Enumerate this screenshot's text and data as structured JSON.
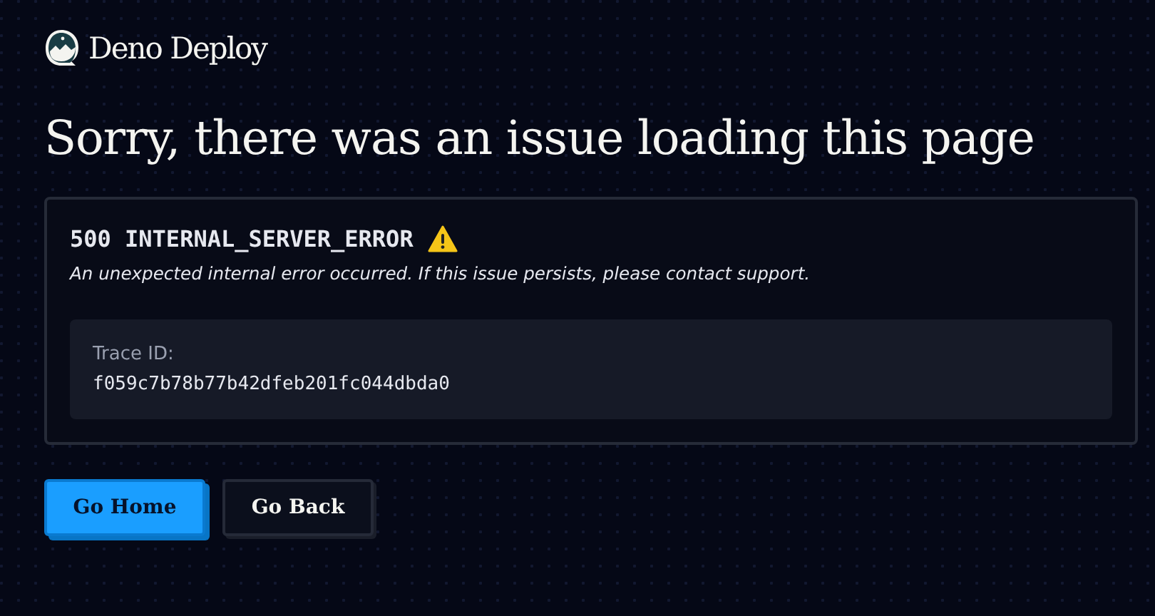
{
  "brand": {
    "name": "Deno Deploy"
  },
  "heading": "Sorry, there was an issue loading this page",
  "error": {
    "code": "500 INTERNAL_SERVER_ERROR",
    "message": "An unexpected internal error occurred. If this issue persists, please contact support.",
    "trace_label": "Trace ID:",
    "trace_id": "f059c7b78b77b42dfeb201fc044dbda0"
  },
  "buttons": [
    {
      "label": "Go Home",
      "kind": "primary"
    },
    {
      "label": "Go Back",
      "kind": "secondary"
    }
  ]
}
